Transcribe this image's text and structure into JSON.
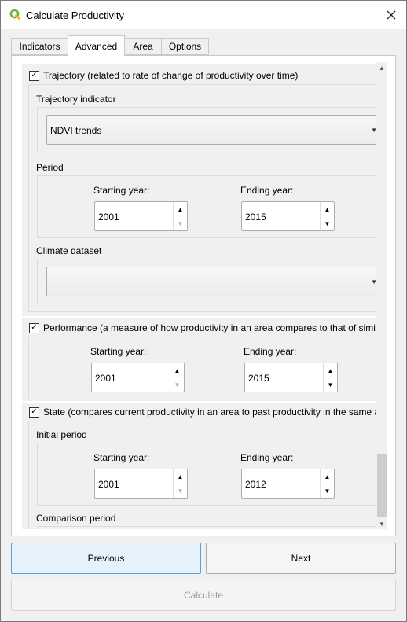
{
  "window": {
    "title": "Calculate Productivity"
  },
  "tabs": [
    {
      "label": "Indicators"
    },
    {
      "label": "Advanced"
    },
    {
      "label": "Area"
    },
    {
      "label": "Options"
    }
  ],
  "trajectory": {
    "checkbox_label": "Trajectory (related to rate of change of  productivity over time)",
    "checked": true,
    "indicator_label": "Trajectory indicator",
    "indicator_value": "NDVI trends",
    "period_label": "Period",
    "start_label": "Starting year:",
    "start_value": "2001",
    "end_label": "Ending year:",
    "end_value": "2015",
    "climate_label": "Climate dataset",
    "climate_value": ""
  },
  "performance": {
    "checkbox_label": "Performance (a measure of how productivity in an area compares to that of similar areas)",
    "checked": true,
    "start_label": "Starting year:",
    "start_value": "2001",
    "end_label": "Ending year:",
    "end_value": "2015"
  },
  "state": {
    "checkbox_label": "State (compares current productivity in an area to past productivity in the same area)",
    "checked": true,
    "initial_period_label": "Initial period",
    "start_label": "Starting year:",
    "start_value": "2001",
    "end_label": "Ending year:",
    "end_value": "2012",
    "comparison_period_label": "Comparison period"
  },
  "buttons": {
    "previous": "Previous",
    "next": "Next",
    "calculate": "Calculate"
  },
  "colors": {
    "accent_border": "#5a9fd6",
    "accent_fill": "#e5f1fb",
    "qgis_green": "#6cb33f"
  }
}
